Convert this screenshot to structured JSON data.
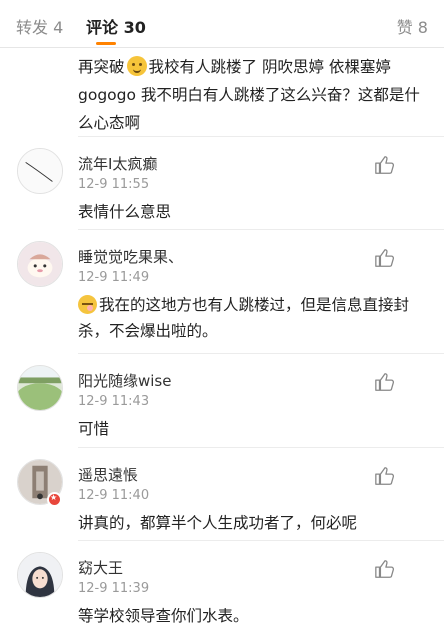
{
  "tabs": {
    "forward": "转发 4",
    "comment": "评论 30",
    "like": "赞 8"
  },
  "top_comment": {
    "text_before_emoji": "再突破",
    "text_after_emoji": "我校有人跳楼了 阴吹思婷 依棵塞婷 gogogo 我不明白有人跳楼了这么兴奋？这都是什么心态啊"
  },
  "comments": [
    {
      "name": "流年I太疯癫",
      "time": "12-9 11:55",
      "text": "表情什么意思"
    },
    {
      "name": "睡觉觉吃果果、",
      "time": "12-9 11:49",
      "text": "我在的这地方也有人跳楼过，但是信息直接封杀，不会爆出啦的。"
    },
    {
      "name": "阳光随缘wise",
      "time": "12-9 11:43",
      "text": "可惜"
    },
    {
      "name": "遥思遠悵",
      "time": "12-9 11:40",
      "text": "讲真的，都算半个人生成功者了，何必呢"
    },
    {
      "name": "窈大王",
      "time": "12-9 11:39",
      "text": "等学校领导查你们水表。"
    }
  ],
  "icons": {
    "like": "thumbs-up-icon",
    "emoji": "emoji-icon",
    "verified": "verified-badge-icon"
  },
  "colors": {
    "active_tab_underline": "#ff8200",
    "verified_badge": "#e8463b"
  }
}
